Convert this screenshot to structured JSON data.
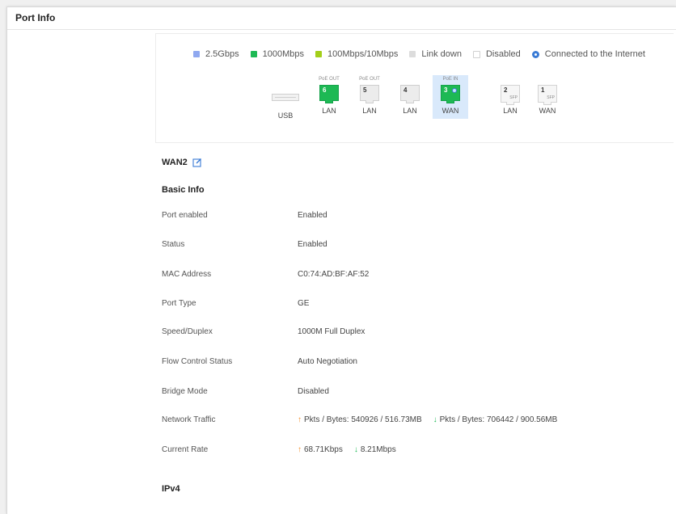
{
  "panel": {
    "title": "Port Info"
  },
  "legend": [
    {
      "label": "2.5Gbps",
      "color": "#8fa8f0"
    },
    {
      "label": "1000Mbps",
      "color": "#1db954"
    },
    {
      "label": "100Mbps/10Mbps",
      "color": "#a3cf1a"
    },
    {
      "label": "Link down",
      "color": "#dcdcdc"
    },
    {
      "label": "Disabled",
      "color": "#ffffff"
    },
    {
      "label": "Connected to the Internet",
      "icon": "globe-icon",
      "color": "#3a7bd5"
    }
  ],
  "ports": {
    "usb": {
      "label": "USB"
    },
    "p6": {
      "top": "PoE OUT",
      "num": "6",
      "label": "LAN",
      "state": "1000Mbps"
    },
    "p5": {
      "top": "PoE OUT",
      "num": "5",
      "label": "LAN",
      "state": "Link down"
    },
    "p4": {
      "top": "",
      "num": "4",
      "label": "LAN",
      "state": "Link down"
    },
    "p3": {
      "top": "PoE IN",
      "num": "3",
      "label": "WAN",
      "state": "1000Mbps",
      "internet": true,
      "selected": true
    },
    "p2": {
      "num": "2",
      "sfp": "SFP",
      "label": "LAN"
    },
    "p1": {
      "num": "1",
      "sfp": "SFP",
      "label": "WAN"
    }
  },
  "wan": {
    "title": "WAN2",
    "edit_icon": "edit-icon"
  },
  "basic_info": {
    "title": "Basic Info",
    "rows": [
      {
        "label": "Port enabled",
        "value": "Enabled"
      },
      {
        "label": "Status",
        "value": "Enabled"
      },
      {
        "label": "MAC Address",
        "value": "C0:74:AD:BF:AF:52"
      },
      {
        "label": "Port Type",
        "value": "GE"
      },
      {
        "label": "Speed/Duplex",
        "value": "1000M Full Duplex"
      },
      {
        "label": "Flow Control Status",
        "value": "Auto Negotiation"
      },
      {
        "label": "Bridge Mode",
        "value": "Disabled"
      }
    ],
    "network_traffic": {
      "label": "Network Traffic",
      "up": "Pkts / Bytes: 540926 / 516.73MB",
      "down": "Pkts / Bytes: 706442 / 900.56MB"
    },
    "current_rate": {
      "label": "Current Rate",
      "up": "68.71Kbps",
      "down": "8.21Mbps"
    }
  },
  "ipv4": {
    "title": "IPv4"
  }
}
